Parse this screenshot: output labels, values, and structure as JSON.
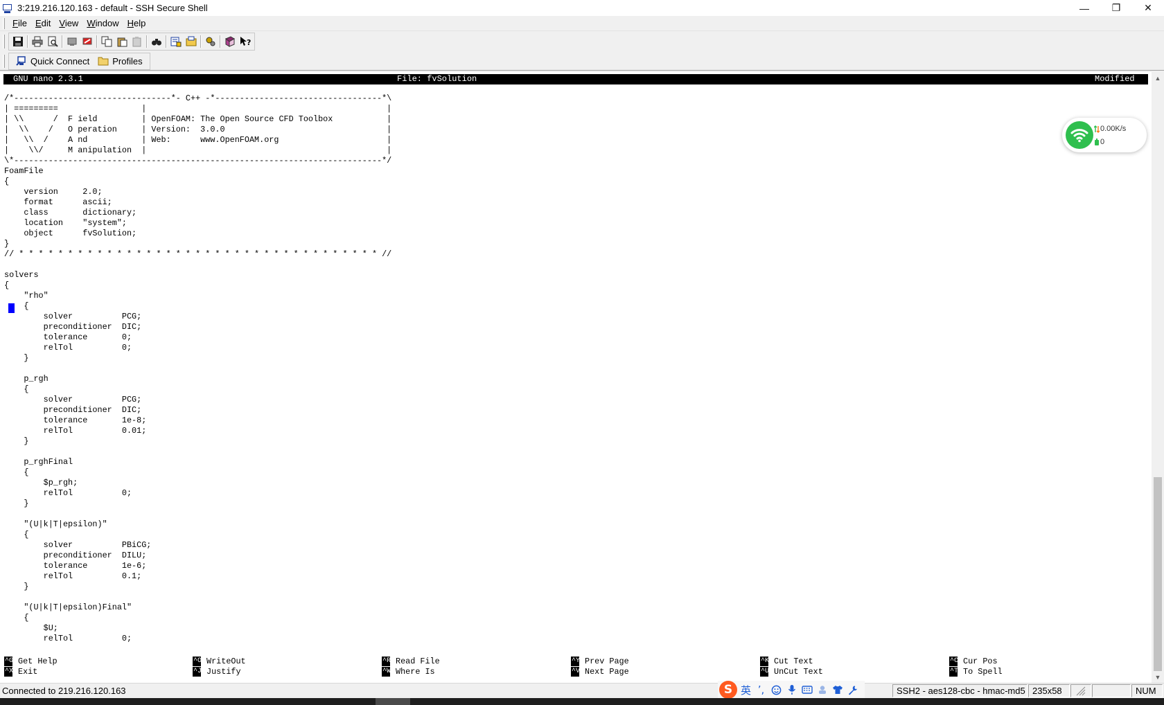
{
  "window": {
    "title": "3:219.216.120.163 - default - SSH Secure Shell",
    "minimize_glyph": "—",
    "maximize_glyph": "❐",
    "close_glyph": "✕"
  },
  "menu": [
    {
      "label": "File",
      "accel": "F",
      "rest": "ile"
    },
    {
      "label": "Edit",
      "accel": "E",
      "rest": "dit"
    },
    {
      "label": "View",
      "accel": "V",
      "rest": "iew"
    },
    {
      "label": "Window",
      "accel": "W",
      "rest": "indow"
    },
    {
      "label": "Help",
      "accel": "H",
      "rest": "elp"
    }
  ],
  "toolbar": {
    "icons": [
      "save-icon",
      "print-icon",
      "print-preview-icon",
      "new-terminal-icon",
      "new-file-transfer-icon",
      "copy-icon",
      "paste-icon",
      "paste-disabled-icon",
      "find-icon",
      "settings-icon",
      "profiles-icon",
      "keys-icon",
      "help-book-icon",
      "context-help-icon"
    ]
  },
  "quickbar": {
    "quick_connect_label": "Quick Connect",
    "profiles_label": "Profiles"
  },
  "terminal": {
    "header": {
      "app": "GNU nano 2.3.1",
      "file": "File: fvSolution",
      "state": "Modified"
    },
    "lines": [
      "/*--------------------------------*- C++ -*----------------------------------*\\",
      "| =========                 |                                                 |",
      "| \\\\      /  F ield         | OpenFOAM: The Open Source CFD Toolbox           |",
      "|  \\\\    /   O peration     | Version:  3.0.0                                 |",
      "|   \\\\  /    A nd           | Web:      www.OpenFOAM.org                      |",
      "|    \\\\/     M anipulation  |                                                 |",
      "\\*---------------------------------------------------------------------------*/",
      "FoamFile",
      "{",
      "    version     2.0;",
      "    format      ascii;",
      "    class       dictionary;",
      "    location    \"system\";",
      "    object      fvSolution;",
      "}",
      "// * * * * * * * * * * * * * * * * * * * * * * * * * * * * * * * * * * * * * //",
      "",
      "solvers",
      "{",
      "    \"rho\"",
      "    {",
      "        solver          PCG;",
      "        preconditioner  DIC;",
      "        tolerance       0;",
      "        relTol          0;",
      "    }",
      "",
      "    p_rgh",
      "    {",
      "        solver          PCG;",
      "        preconditioner  DIC;",
      "        tolerance       1e-8;",
      "        relTol          0.01;",
      "    }",
      "",
      "    p_rghFinal",
      "    {",
      "        $p_rgh;",
      "        relTol          0;",
      "    }",
      "",
      "    \"(U|k|T|epsilon)\"",
      "    {",
      "        solver          PBiCG;",
      "        preconditioner  DILU;",
      "        tolerance       1e-6;",
      "        relTol          0.1;",
      "    }",
      "",
      "    \"(U|k|T|epsilon)Final\"",
      "    {",
      "        $U;",
      "        relTol          0;"
    ],
    "shortcuts": [
      {
        "top_key": "^G",
        "top_label": "Get Help",
        "bottom_key": "^X",
        "bottom_label": "Exit"
      },
      {
        "top_key": "^O",
        "top_label": "WriteOut",
        "bottom_key": "^J",
        "bottom_label": "Justify"
      },
      {
        "top_key": "^R",
        "top_label": "Read File",
        "bottom_key": "^W",
        "bottom_label": "Where Is"
      },
      {
        "top_key": "^Y",
        "top_label": "Prev Page",
        "bottom_key": "^V",
        "bottom_label": "Next Page"
      },
      {
        "top_key": "^K",
        "top_label": "Cut Text",
        "bottom_key": "^U",
        "bottom_label": "UnCut Text"
      },
      {
        "top_key": "^C",
        "top_label": "Cur Pos",
        "bottom_key": "^T",
        "bottom_label": "To Spell"
      }
    ]
  },
  "scrollbar": {
    "up_glyph": "▲",
    "down_glyph": "▼"
  },
  "network_widget": {
    "speed": "0.00K/s",
    "count": "0"
  },
  "statusbar": {
    "connection": "Connected to 219.216.120.163",
    "cipher": "SSH2 - aes128-cbc - hmac-md5",
    "size": "235x58",
    "num": "NUM"
  },
  "ime": {
    "logo": "S",
    "lang": "英",
    "punct": "ʼ,",
    "icons": [
      "emoji-icon",
      "microphone-icon",
      "keyboard-icon",
      "skin-icon",
      "shirt-icon",
      "wrench-icon"
    ]
  },
  "colors": {
    "terminal_bg": "#ffffff",
    "terminal_fg": "#000000",
    "cursor": "#0000ff",
    "header_bg": "#000000",
    "net_green": "#2fbf4e",
    "ime_orange": "#ff5a1f"
  }
}
